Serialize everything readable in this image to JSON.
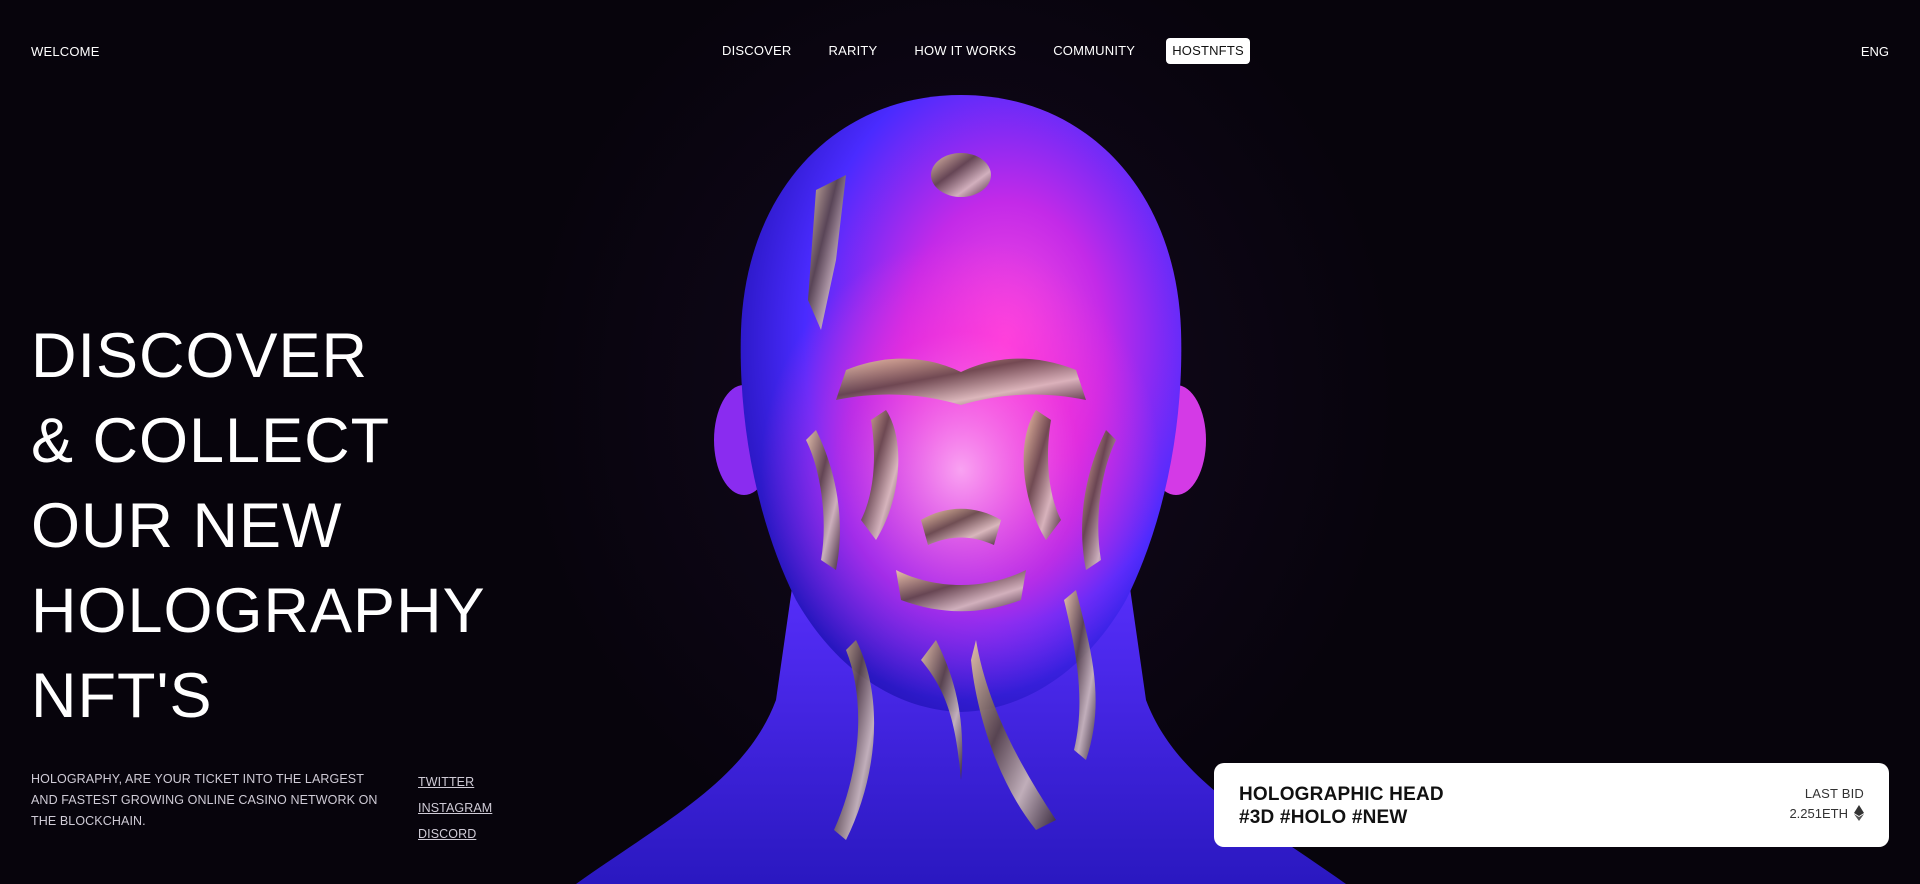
{
  "header": {
    "logo": "WELCOME",
    "nav": [
      "DISCOVER",
      "RARITY",
      "HOW IT WORKS",
      "COMMUNITY"
    ],
    "cta": "HOSTNFTS",
    "lang": "ENG"
  },
  "hero": {
    "headline_lines": [
      "DISCOVER",
      "& COLLECT",
      "OUR NEW",
      "HOLOGRAPHY",
      "NFT'S"
    ],
    "tagline": "HOLOGRAPHY, ARE YOUR TICKET INTO THE LARGEST AND FASTEST GROWING ONLINE CASINO NETWORK ON THE BLOCKCHAIN.",
    "socials": [
      "TWITTER",
      "INSTAGRAM",
      "DISCORD"
    ]
  },
  "card": {
    "title_line1": "HOLOGRAPHIC HEAD",
    "title_line2": "#3D #HOLO #NEW",
    "bid_label": "LAST BID",
    "bid_value": "2.251ETH",
    "icon": "ethereum-icon"
  },
  "colors": {
    "background": "#07040c",
    "accent_pink": "#ff2fd0",
    "accent_blue": "#3b22ff",
    "card_bg": "#ffffff"
  }
}
